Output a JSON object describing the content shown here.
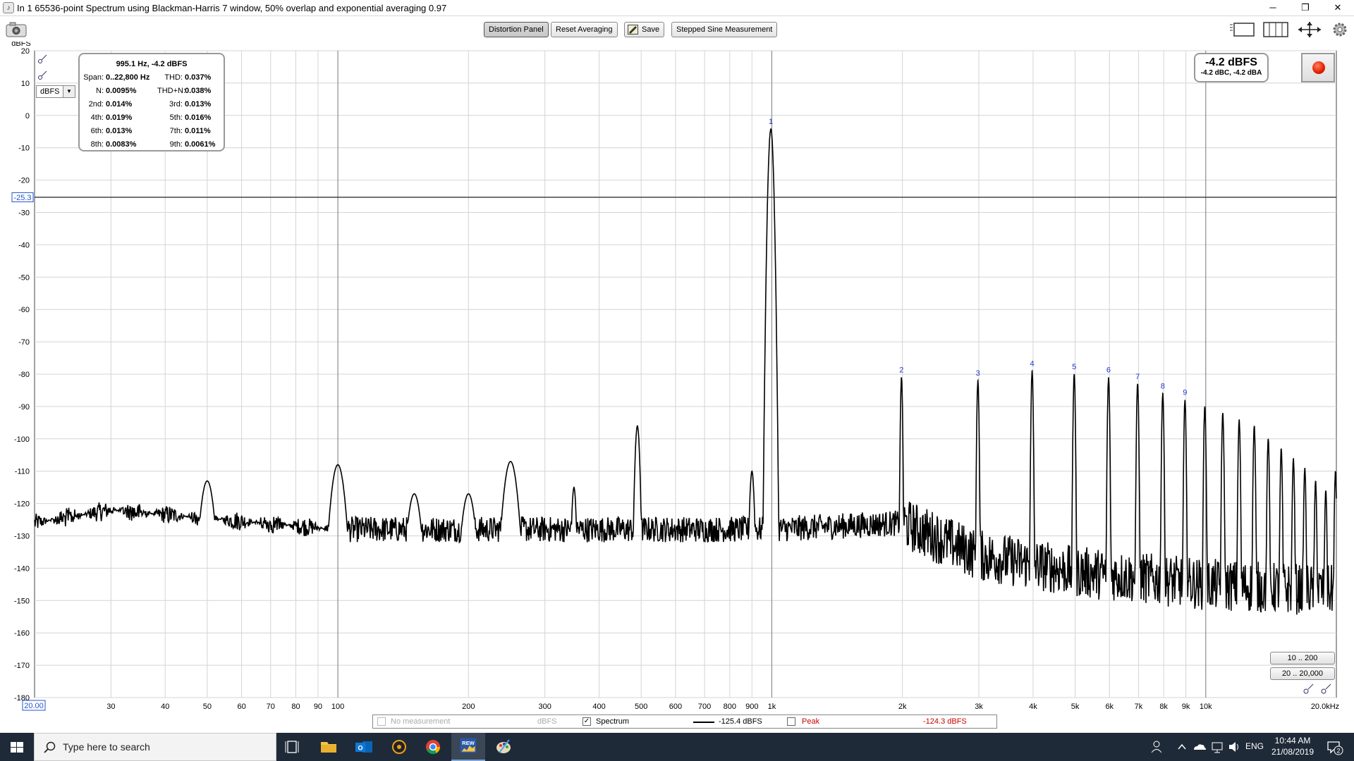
{
  "window": {
    "title": "In 1 65536-point Spectrum using Blackman-Harris 7 window, 50% overlap and exponential averaging 0.97",
    "minimize": "─",
    "restore": "❐",
    "close": "✕"
  },
  "toolbar": {
    "distortion_panel": "Distortion Panel",
    "reset_averaging": "Reset Averaging",
    "save": "Save",
    "stepped_sine": "Stepped Sine Measurement"
  },
  "graph": {
    "ylabel": "dBFS",
    "unit_select": "dBFS",
    "cursor_level_label": "-25.3",
    "x_start_label": "20.00",
    "y_ticks": [
      "20",
      "10",
      "0",
      "-10",
      "-20",
      "-30",
      "-40",
      "-50",
      "-60",
      "-70",
      "-80",
      "-90",
      "-100",
      "-110",
      "-120",
      "-130",
      "-140",
      "-150",
      "-160",
      "-170",
      "-180"
    ],
    "x_ticks": [
      {
        "f": 30,
        "label": "30"
      },
      {
        "f": 40,
        "label": "40"
      },
      {
        "f": 50,
        "label": "50"
      },
      {
        "f": 60,
        "label": "60"
      },
      {
        "f": 70,
        "label": "70"
      },
      {
        "f": 80,
        "label": "80"
      },
      {
        "f": 90,
        "label": "90"
      },
      {
        "f": 100,
        "label": "100"
      },
      {
        "f": 200,
        "label": "200"
      },
      {
        "f": 300,
        "label": "300"
      },
      {
        "f": 400,
        "label": "400"
      },
      {
        "f": 500,
        "label": "500"
      },
      {
        "f": 600,
        "label": "600"
      },
      {
        "f": 700,
        "label": "700"
      },
      {
        "f": 800,
        "label": "800"
      },
      {
        "f": 900,
        "label": "900"
      },
      {
        "f": 1000,
        "label": "1k"
      },
      {
        "f": 2000,
        "label": "2k"
      },
      {
        "f": 3000,
        "label": "3k"
      },
      {
        "f": 4000,
        "label": "4k"
      },
      {
        "f": 5000,
        "label": "5k"
      },
      {
        "f": 6000,
        "label": "6k"
      },
      {
        "f": 7000,
        "label": "7k"
      },
      {
        "f": 8000,
        "label": "8k"
      },
      {
        "f": 9000,
        "label": "9k"
      },
      {
        "f": 10000,
        "label": "10k"
      },
      {
        "f": 20000,
        "label": "20.0kHz"
      }
    ]
  },
  "distortion": {
    "header": "995.1 Hz, -4.2 dBFS",
    "span_label": "Span:",
    "span_value": "0..22,800 Hz",
    "thd_label": "THD:",
    "thd_value": "0.037%",
    "n_label": "N:",
    "n_value": "0.0095%",
    "thdn_label": "THD+N:",
    "thdn_value": "0.038%",
    "h2_label": "2nd:",
    "h2_value": "0.014%",
    "h3_label": "3rd:",
    "h3_value": "0.013%",
    "h4_label": "4th:",
    "h4_value": "0.019%",
    "h5_label": "5th:",
    "h5_value": "0.016%",
    "h6_label": "6th:",
    "h6_value": "0.013%",
    "h7_label": "7th:",
    "h7_value": "0.011%",
    "h8_label": "8th:",
    "h8_value": "0.0083%",
    "h9_label": "9th:",
    "h9_value": "0.0061%"
  },
  "level": {
    "main": "-4.2 dBFS",
    "sub": "-4.2 dBC, -4.2 dBA"
  },
  "range_buttons": {
    "r1": "10 .. 200",
    "r2": "20 .. 20,000"
  },
  "legend": {
    "no_measurement": "No measurement",
    "no_measurement_unit": "dBFS",
    "spectrum": "Spectrum",
    "spectrum_value": "-125.4 dBFS",
    "peak": "Peak",
    "peak_value": "-124.3 dBFS"
  },
  "chart_data": {
    "type": "line",
    "title": "",
    "xlabel": "",
    "ylabel": "dBFS",
    "xscale": "log",
    "xlim": [
      20,
      20000
    ],
    "ylim": [
      -180,
      20
    ],
    "grid": true,
    "cursor_level_dbfs": -25.3,
    "fundamental": {
      "f": 995.1,
      "level": -4.2
    },
    "harmonics": [
      {
        "label": "1",
        "f": 995,
        "level": -4.2
      },
      {
        "label": "2",
        "f": 1990,
        "level": -81
      },
      {
        "label": "3",
        "f": 2985,
        "level": -82
      },
      {
        "label": "4",
        "f": 3980,
        "level": -79
      },
      {
        "label": "5",
        "f": 4976,
        "level": -80
      },
      {
        "label": "6",
        "f": 5971,
        "level": -81
      },
      {
        "label": "7",
        "f": 6966,
        "level": -83
      },
      {
        "label": "8",
        "f": 7961,
        "level": -86
      },
      {
        "label": "9",
        "f": 8956,
        "level": -88
      }
    ],
    "higher_harmonic_peaks": [
      {
        "f": 9951,
        "level": -90
      },
      {
        "f": 10946,
        "level": -92
      },
      {
        "f": 11941,
        "level": -94
      },
      {
        "f": 12936,
        "level": -96
      },
      {
        "f": 13931,
        "level": -100
      },
      {
        "f": 14927,
        "level": -103
      },
      {
        "f": 15922,
        "level": -106
      },
      {
        "f": 16917,
        "level": -109
      },
      {
        "f": 17912,
        "level": -113
      },
      {
        "f": 18907,
        "level": -116
      },
      {
        "f": 19902,
        "level": -110
      }
    ],
    "other_spurs": [
      {
        "f": 50,
        "level": -113
      },
      {
        "f": 100,
        "level": -108
      },
      {
        "f": 150,
        "level": -117
      },
      {
        "f": 200,
        "level": -117
      },
      {
        "f": 250,
        "level": -107
      },
      {
        "f": 350,
        "level": -115
      },
      {
        "f": 490,
        "level": -96
      },
      {
        "f": 900,
        "level": -110
      }
    ],
    "noise_floor": [
      {
        "f": 20,
        "level": -126
      },
      {
        "f": 30,
        "level": -122
      },
      {
        "f": 100,
        "level": -128
      },
      {
        "f": 500,
        "level": -128
      },
      {
        "f": 1000,
        "level": -128
      },
      {
        "f": 2000,
        "level": -126
      },
      {
        "f": 3000,
        "level": -136
      },
      {
        "f": 5000,
        "level": -141
      },
      {
        "f": 10000,
        "level": -145
      },
      {
        "f": 20000,
        "level": -147
      }
    ]
  },
  "taskbar": {
    "search_placeholder": "Type here to search",
    "lang": "ENG",
    "time": "10:44 AM",
    "date": "21/08/2019",
    "notification_count": "2"
  },
  "icons": {
    "camera": "camera-icon",
    "settings": "gear-icon",
    "record": "record-icon"
  }
}
